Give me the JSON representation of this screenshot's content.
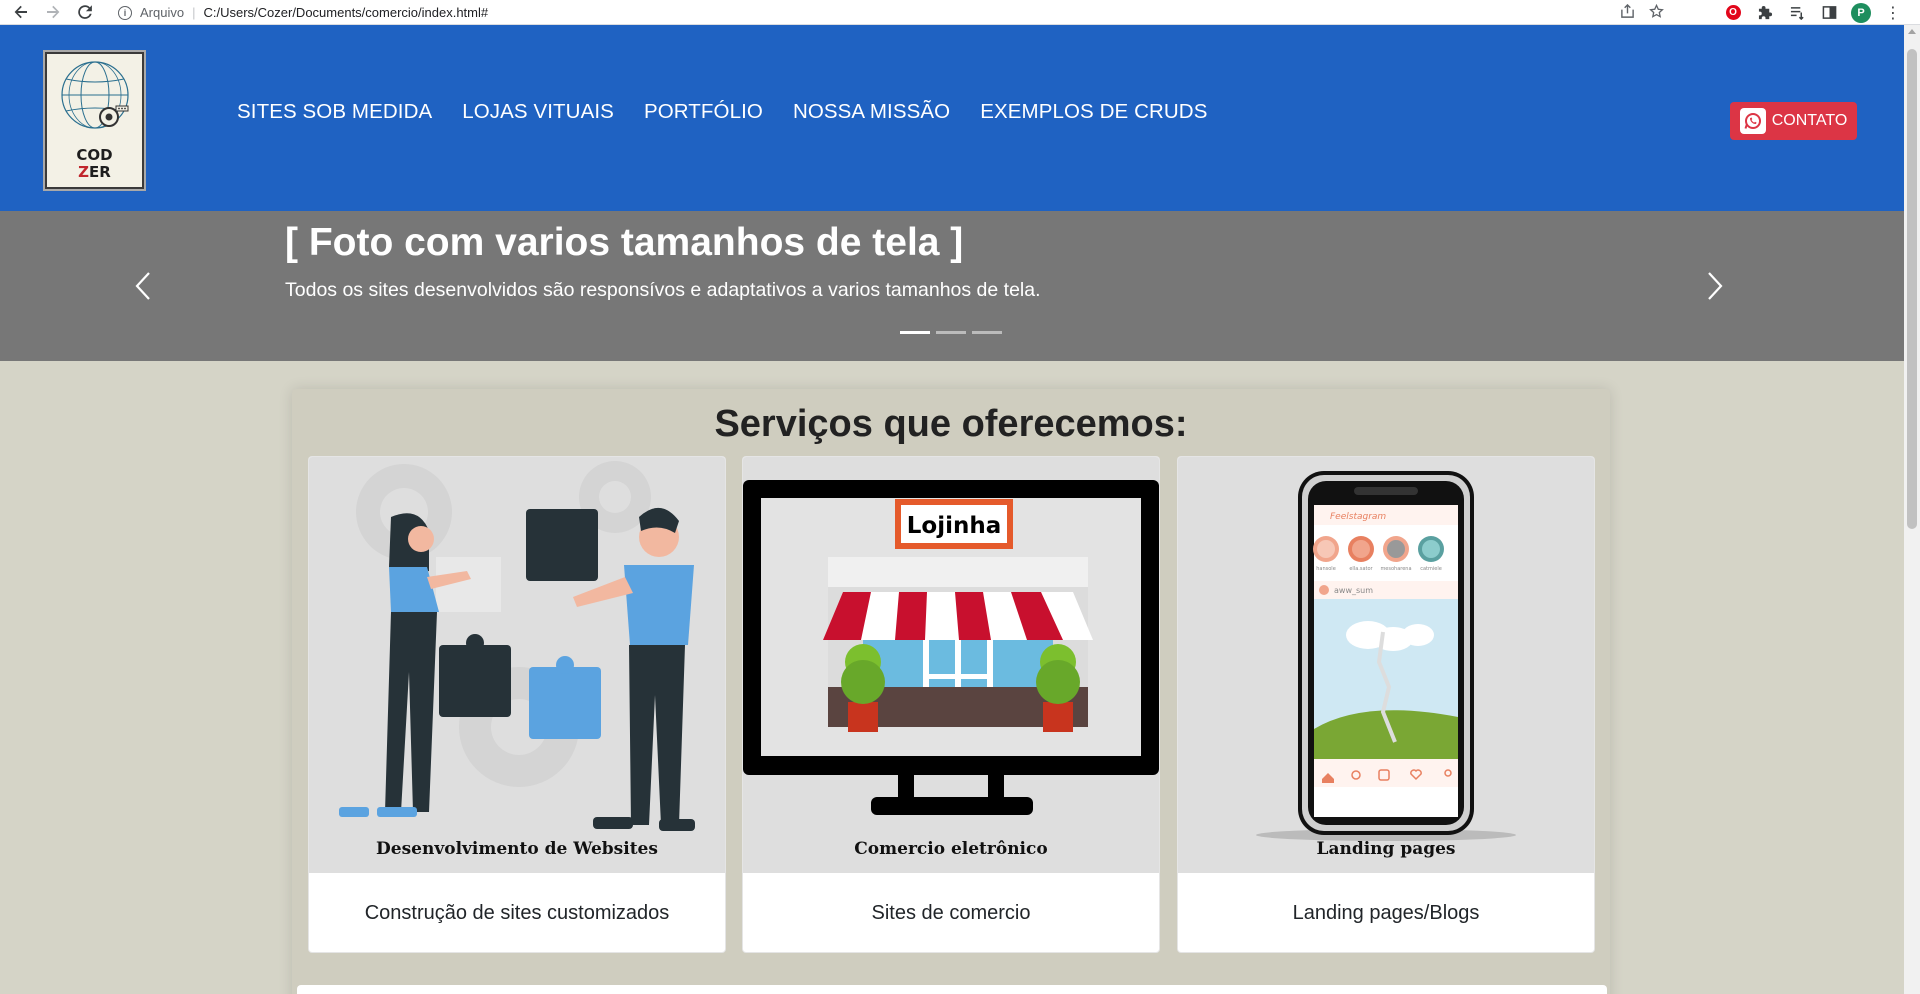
{
  "browser": {
    "scheme_label": "Arquivo",
    "url": "C:/Users/Cozer/Documents/comercio/index.html#",
    "profile_initial": "P"
  },
  "header": {
    "logo_line1": "COD",
    "logo_line2_accent": "Z",
    "logo_line2_rest": "ER",
    "nav": [
      {
        "label": "SITES SOB MEDIDA"
      },
      {
        "label": "LOJAS VITUAIS"
      },
      {
        "label": "PORTFÓLIO"
      },
      {
        "label": "NOSSA MISSÃO"
      },
      {
        "label": "EXEMPLOS DE CRUDS"
      }
    ],
    "contact_label": "CONTATO"
  },
  "carousel": {
    "title": "[ Foto com varios tamanhos de tela ]",
    "text": "Todos os sites desenvolvidos são responsívos e adaptativos a varios tamanhos de tela.",
    "slide_count": 3,
    "active_slide": 1
  },
  "services": {
    "title": "Serviços que oferecemos:",
    "cards": [
      {
        "image_caption": "Desenvolvimento de Websites",
        "label": "Construção de sites customizados"
      },
      {
        "image_caption": "Comercio eletrônico",
        "label": "Sites de comercio",
        "sign_text": "Lojinha"
      },
      {
        "image_caption": "Landing pages",
        "label": "Landing pages/Blogs",
        "phone_app_name": "Feelstagram",
        "phone_post_user": "aww_sum",
        "phone_stories": [
          "hansole",
          "ella.sator",
          "mesoharena",
          "catmiele"
        ]
      }
    ]
  },
  "colors": {
    "header_bg": "#1f62c2",
    "carousel_bg": "#777777",
    "page_bg": "#d5d4c7",
    "contact_btn": "#dc3545"
  }
}
